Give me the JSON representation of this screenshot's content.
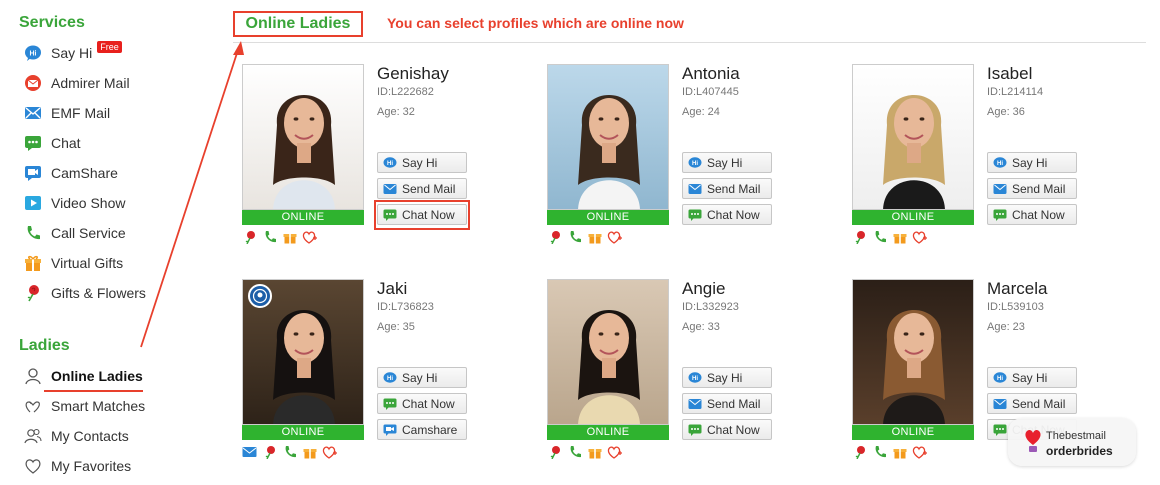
{
  "sidebar": {
    "services_title": "Services",
    "services": [
      {
        "label": "Say Hi",
        "icon": "say-hi-icon",
        "badge": "Free"
      },
      {
        "label": "Admirer Mail",
        "icon": "admirer-mail-icon"
      },
      {
        "label": "EMF Mail",
        "icon": "emf-mail-icon"
      },
      {
        "label": "Chat",
        "icon": "chat-icon"
      },
      {
        "label": "CamShare",
        "icon": "camshare-icon"
      },
      {
        "label": "Video Show",
        "icon": "video-show-icon"
      },
      {
        "label": "Call Service",
        "icon": "phone-icon"
      },
      {
        "label": "Virtual Gifts",
        "icon": "gift-icon"
      },
      {
        "label": "Gifts & Flowers",
        "icon": "rose-icon"
      }
    ],
    "ladies_title": "Ladies",
    "ladies": [
      {
        "label": "Online Ladies",
        "icon": "person-icon",
        "active": true
      },
      {
        "label": "Smart Matches",
        "icon": "hearts-icon"
      },
      {
        "label": "My Contacts",
        "icon": "contacts-icon"
      },
      {
        "label": "My Favorites",
        "icon": "heart-outline-icon"
      }
    ]
  },
  "header": {
    "title": "Online Ladies",
    "note": "You can select profiles which are online now"
  },
  "online_label": "ONLINE",
  "profiles": [
    {
      "name": "Genishay",
      "id": "ID:L222682",
      "age": "Age: 32",
      "buttons": [
        "Say Hi",
        "Send Mail",
        "Chat Now"
      ]
    },
    {
      "name": "Antonia",
      "id": "ID:L407445",
      "age": "Age: 24",
      "buttons": [
        "Say Hi",
        "Send Mail",
        "Chat Now"
      ]
    },
    {
      "name": "Isabel",
      "id": "ID:L214114",
      "age": "Age: 36",
      "buttons": [
        "Say Hi",
        "Send Mail",
        "Chat Now"
      ]
    },
    {
      "name": "Jaki",
      "id": "ID:L736823",
      "age": "Age: 35",
      "buttons": [
        "Say Hi",
        "Chat Now",
        "Camshare"
      ]
    },
    {
      "name": "Angie",
      "id": "ID:L332923",
      "age": "Age: 33",
      "buttons": [
        "Say Hi",
        "Send Mail",
        "Chat Now"
      ]
    },
    {
      "name": "Marcela",
      "id": "ID:L539103",
      "age": "Age: 23",
      "buttons": [
        "Say Hi",
        "Send Mail",
        "Chat Now"
      ]
    }
  ],
  "watermark": {
    "line1": "Thebestmail",
    "line2": "orderbrides"
  },
  "colors": {
    "green": "#3aa53a",
    "online_green": "#2fb32f",
    "red": "#e8402d",
    "blue": "#2a86d6"
  }
}
